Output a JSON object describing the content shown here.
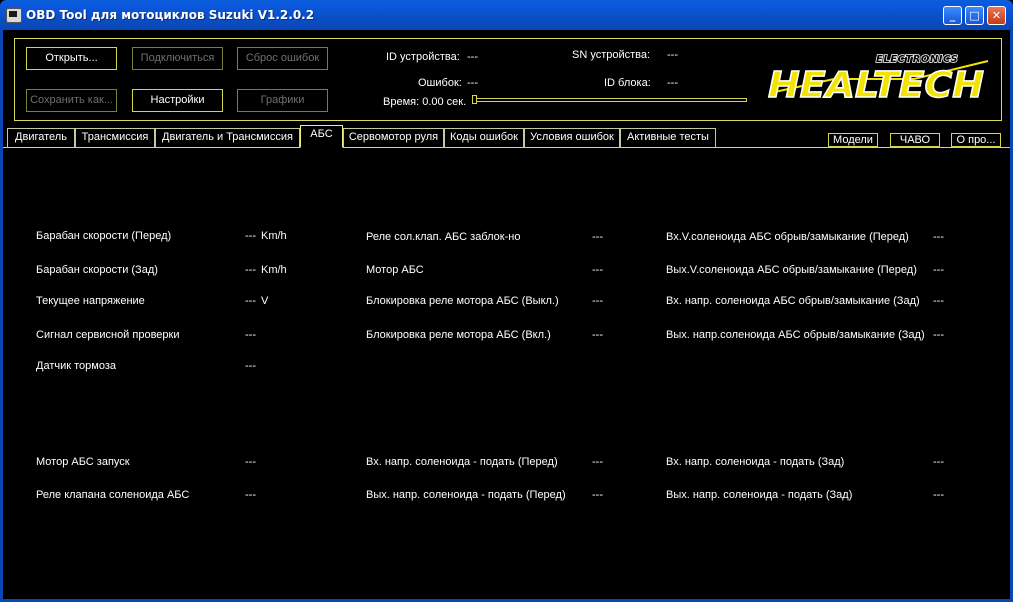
{
  "window": {
    "title": "OBD Tool для мотоциклов Suzuki V1.2.0.2",
    "minimize_glyph": "_",
    "maximize_glyph": "□",
    "close_glyph": "✕"
  },
  "toolbar": {
    "open": "Открыть...",
    "connect": "Подключиться",
    "reset_errors": "Сброс ошибок",
    "save_as": "Сохранить как...",
    "settings": "Настройки",
    "graphs": "Графики"
  },
  "device": {
    "id_label": "ID устройства:",
    "id_value": "---",
    "sn_label": "SN устройства:",
    "sn_value": "---",
    "errors_label": "Ошибок:",
    "errors_value": "---",
    "block_label": "ID блока:",
    "block_value": "---",
    "time_label": "Время: 0.00 сек.",
    "progress": 0
  },
  "logo": {
    "line1": "ELECTRONICS",
    "line2": "HEALTECH",
    "colors": {
      "yellow": "#f2e400",
      "outline": "#ffffff"
    }
  },
  "tabs": [
    {
      "label": "Двигатель",
      "active": false
    },
    {
      "label": "Трансмиссия",
      "active": false
    },
    {
      "label": "Двигатель и Трансмиссия",
      "active": false
    },
    {
      "label": "АБС",
      "active": true
    },
    {
      "label": "Сервомотор руля",
      "active": false
    },
    {
      "label": "Коды ошибок",
      "active": false
    },
    {
      "label": "Условия ошибок",
      "active": false
    },
    {
      "label": "Активные тесты",
      "active": false
    }
  ],
  "side_buttons": {
    "models": "Модели",
    "faq": "ЧАВО",
    "about": "О про..."
  },
  "abs": {
    "rows": [
      {
        "label": "Барабан скорости (Перед)",
        "value": "---",
        "unit": "Km/h"
      },
      {
        "label": "Барабан скорости (Зад)",
        "value": "---",
        "unit": "Km/h"
      },
      {
        "label": "Текущее напряжение",
        "value": "---",
        "unit": "V"
      },
      {
        "label": "Сигнал сервисной проверки",
        "value": "---",
        "unit": ""
      },
      {
        "label": "Датчик тормоза",
        "value": "---",
        "unit": ""
      },
      {
        "label": "Мотор АБС запуск",
        "value": "---",
        "unit": ""
      },
      {
        "label": "Реле клапана соленоида АБС",
        "value": "---",
        "unit": ""
      },
      {
        "label": "Реле сол.клап. АБС заблок-но",
        "value": "---",
        "unit": ""
      },
      {
        "label": "Мотор АБС",
        "value": "---",
        "unit": ""
      },
      {
        "label": "Блокировка реле мотора АБС (Выкл.)",
        "value": "---",
        "unit": ""
      },
      {
        "label": "Блокировка реле мотора АБС (Вкл.)",
        "value": "---",
        "unit": ""
      },
      {
        "label": "Вх. напр. соленоида - подать (Перед)",
        "value": "---",
        "unit": ""
      },
      {
        "label": "Вых. напр. соленоида - подать (Перед)",
        "value": "---",
        "unit": ""
      },
      {
        "label": "Вх.V.соленоида АБС обрыв/замыкание (Перед)",
        "value": "---",
        "unit": ""
      },
      {
        "label": "Вых.V.соленоида АБС обрыв/замыкание (Перед)",
        "value": "---",
        "unit": ""
      },
      {
        "label": "Вх. напр. соленоида АБС обрыв/замыкание (Зад)",
        "value": "---",
        "unit": ""
      },
      {
        "label": "Вых. напр.соленоида АБС обрыв/замыкание (Зад)",
        "value": "---",
        "unit": ""
      },
      {
        "label": "Вх. напр. соленоида - подать (Зад)",
        "value": "---",
        "unit": ""
      },
      {
        "label": "Вых. напр. соленоида - подать (Зад)",
        "value": "---",
        "unit": ""
      }
    ]
  }
}
